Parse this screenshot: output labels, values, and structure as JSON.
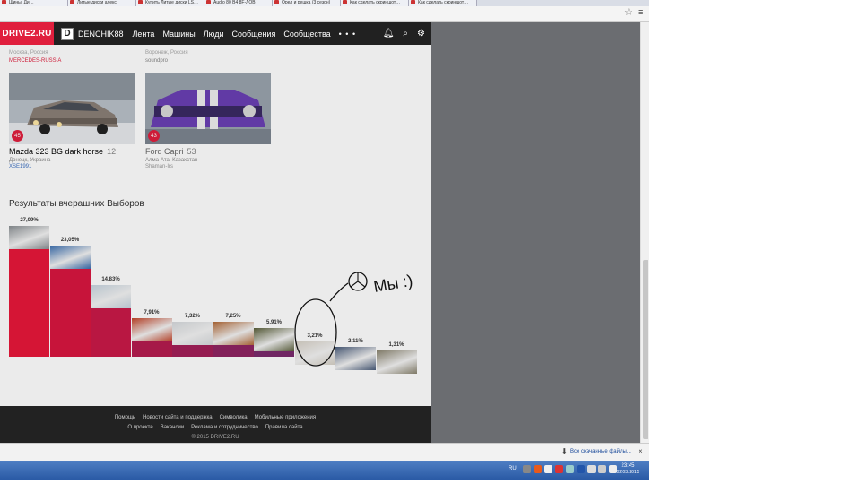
{
  "browser": {
    "tabs": [
      "Шины, Ди…",
      "Литые диски алекс",
      "Купить Литые диски LS…",
      "Audio 80 B4 8F-ЛОВ",
      "Орел и решка (3 сезон)",
      "Как сделать скриншот…",
      "Как сделать скриншот…"
    ],
    "star_icon": "star-icon",
    "menu_icon": "menu-icon"
  },
  "nav": {
    "logo": "DRIVE2.RU",
    "avatar_letter": "D",
    "username": "DENCHIK88",
    "items": [
      "Лента",
      "Машины",
      "Люди",
      "Сообщения",
      "Сообщества"
    ],
    "more": "• • •"
  },
  "topcut": {
    "left_loc": "Москва, Россия",
    "left_user": "MERCEDES-RUSSIA",
    "right_loc": "Воронеж, Россия",
    "right_user": "soundpro"
  },
  "cars": [
    {
      "badge": "45",
      "name": "Mazda 323 BG dark horse",
      "count": "12",
      "location": "Донецк, Украина",
      "user": "XSE1991"
    },
    {
      "badge": "43",
      "name": "Ford Capri",
      "count": "53",
      "location": "Алма-Ата, Казахстан",
      "user": "Shaman-Irs"
    }
  ],
  "section_title": "Результаты вчерашних Выборов",
  "chart_data": {
    "type": "bar",
    "values": [
      27.09,
      23.05,
      14.83,
      7.91,
      7.32,
      7.25,
      5.91,
      3.21,
      2.11,
      1.31
    ],
    "labels": [
      "27,09%",
      "23,05%",
      "14,83%",
      "7,91%",
      "7,32%",
      "7,25%",
      "5,91%",
      "3,21%",
      "2,11%",
      "1,31%"
    ],
    "colors": [
      "#e8173a",
      "#d8163f",
      "#c91a48",
      "#b51c4f",
      "#a21f58",
      "#8f2462",
      "#7a2a6c",
      "#623077",
      "#4c3a80",
      "#374488"
    ],
    "ylim": [
      0,
      27.09
    ]
  },
  "annotation": {
    "text": "Мы :)"
  },
  "footer": {
    "row1": [
      "Помощь",
      "Новости сайта и поддержка",
      "Символика",
      "Мобильные приложения"
    ],
    "row2": [
      "О проекте",
      "Вакансии",
      "Реклама и сотрудничество",
      "Правила сайта"
    ],
    "copyright": "© 2015 DRIVE2.RU"
  },
  "downloads": {
    "label": "Все скачанные файлы..."
  },
  "taskbar": {
    "lang": "RU",
    "time": "23:45",
    "date": "02.03.2015"
  }
}
